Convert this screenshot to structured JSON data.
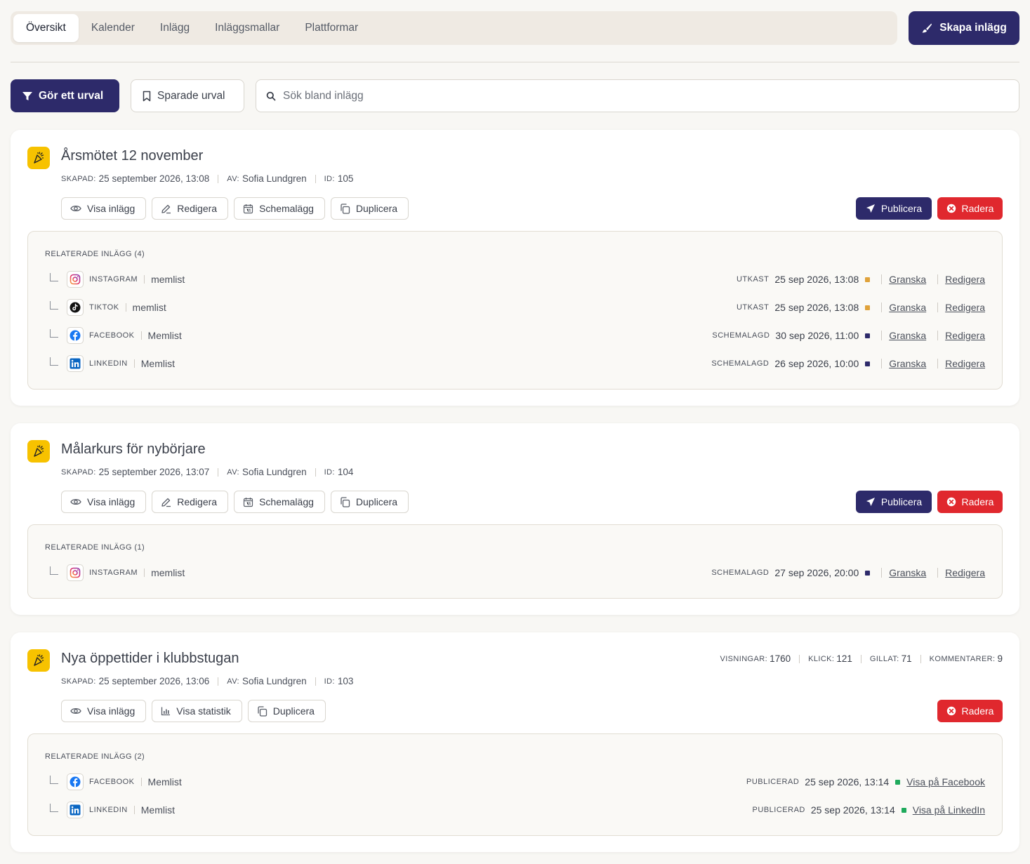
{
  "tabs": [
    {
      "label": "Översikt"
    },
    {
      "label": "Kalender"
    },
    {
      "label": "Inlägg"
    },
    {
      "label": "Inläggsmallar"
    },
    {
      "label": "Plattformar"
    }
  ],
  "create_button": "Skapa inlägg",
  "filter_button": "Gör ett urval",
  "saved_button": "Sparade urval",
  "search_placeholder": "Sök bland inlägg",
  "labels": {
    "created": "SKAPAD:",
    "by": "AV:",
    "id": "ID:",
    "views": "VISNINGAR:",
    "clicks": "KLICK:",
    "likes": "GILLAT:",
    "comments": "KOMMENTARER:"
  },
  "buttons": {
    "view": "Visa inlägg",
    "edit": "Redigera",
    "schedule": "Schemalägg",
    "duplicate": "Duplicera",
    "stats": "Visa statistik",
    "publish": "Publicera",
    "delete": "Radera",
    "review": "Granska",
    "edit_link": "Redigera"
  },
  "posts": [
    {
      "title": "Årsmötet 12 november",
      "created": "25 september 2026, 13:08",
      "author": "Sofia Lundgren",
      "id": "105",
      "related_title": "RELATERADE INLÄGG (4)",
      "related": [
        {
          "platform": "INSTAGRAM",
          "account": "memlist",
          "status": "UTKAST",
          "date": "25 sep 2026, 13:08"
        },
        {
          "platform": "TIKTOK",
          "account": "memlist",
          "status": "UTKAST",
          "date": "25 sep 2026, 13:08"
        },
        {
          "platform": "FACEBOOK",
          "account": "Memlist",
          "status": "SCHEMALAGD",
          "date": "30 sep 2026, 11:00"
        },
        {
          "platform": "LINKEDIN",
          "account": "Memlist",
          "status": "SCHEMALAGD",
          "date": "26 sep 2026, 10:00"
        }
      ]
    },
    {
      "title": "Målarkurs för nybörjare",
      "created": "25 september 2026, 13:07",
      "author": "Sofia Lundgren",
      "id": "104",
      "related_title": "RELATERADE INLÄGG (1)",
      "related": [
        {
          "platform": "INSTAGRAM",
          "account": "memlist",
          "status": "SCHEMALAGD",
          "date": "27 sep 2026, 20:00"
        }
      ]
    },
    {
      "title": "Nya öppettider i klubbstugan",
      "created": "25 september 2026, 13:06",
      "author": "Sofia Lundgren",
      "id": "103",
      "stats": {
        "views": "1760",
        "clicks": "121",
        "likes": "71",
        "comments": "9"
      },
      "related_title": "RELATERADE INLÄGG (2)",
      "related": [
        {
          "platform": "FACEBOOK",
          "account": "Memlist",
          "status": "PUBLICERAD",
          "date": "25 sep 2026, 13:14",
          "link": "Visa på Facebook"
        },
        {
          "platform": "LINKEDIN",
          "account": "Memlist",
          "status": "PUBLICERAD",
          "date": "25 sep 2026, 13:14",
          "link": "Visa på LinkedIn"
        }
      ]
    }
  ],
  "colors": {
    "primary": "#2d2a6a",
    "danger": "#e0282e",
    "draft": "#e0a23a",
    "scheduled": "#2d2a6a",
    "published": "#1faa5c",
    "post_icon": "#f7c200"
  }
}
